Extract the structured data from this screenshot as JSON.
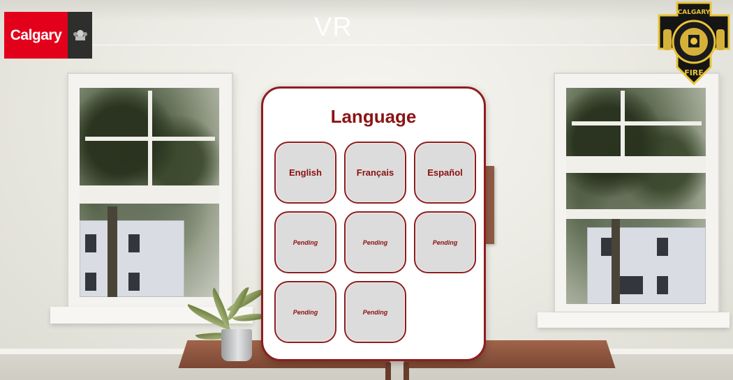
{
  "header": {
    "title": "VR",
    "city_logo_text": "Calgary",
    "fire_badge_top_text": "CALGARY",
    "fire_badge_bottom_text": "FIRE"
  },
  "language_panel": {
    "title": "Language",
    "options": [
      {
        "label": "English",
        "status": "available"
      },
      {
        "label": "Français",
        "status": "available"
      },
      {
        "label": "Español",
        "status": "available"
      },
      {
        "label": "Pending",
        "status": "pending"
      },
      {
        "label": "Pending",
        "status": "pending"
      },
      {
        "label": "Pending",
        "status": "pending"
      },
      {
        "label": "Pending",
        "status": "pending"
      },
      {
        "label": "Pending",
        "status": "pending"
      }
    ]
  },
  "colors": {
    "accent": "#8f1d1d",
    "calgary_red": "#e3001b",
    "button_fill": "#dcdcdc"
  },
  "icons": [
    "calgary-crest-icon",
    "fire-department-badge-icon"
  ]
}
